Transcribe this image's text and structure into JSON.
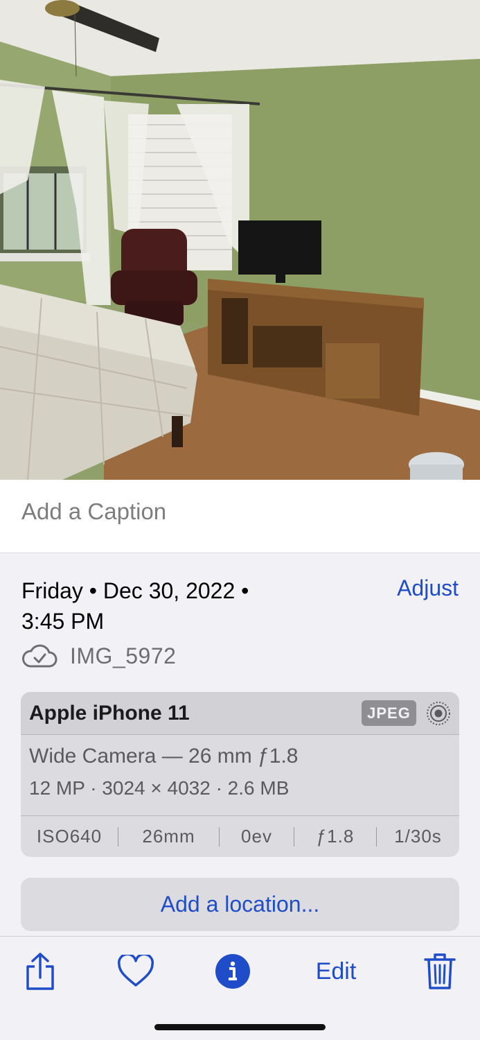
{
  "photo": {
    "description_icon": "bedroom-photo"
  },
  "caption": {
    "placeholder": "Add a Caption"
  },
  "metadata": {
    "date_line1": "Friday • Dec 30, 2022 •",
    "date_line2": "3:45 PM",
    "adjust_label": "Adjust",
    "filename": "IMG_5972",
    "cloud_icon": "icloud-check-icon"
  },
  "camera_card": {
    "device": "Apple iPhone 11",
    "format_badge": "JPEG",
    "live_icon": "live-photo-icon",
    "lens": "Wide Camera — 26 mm ƒ1.8",
    "specs": "12 MP · 3024 × 4032 · 2.6 MB",
    "exif": [
      "ISO640",
      "26mm",
      "0ev",
      "ƒ1.8",
      "1/30s"
    ]
  },
  "location": {
    "label": "Add a location..."
  },
  "toolbar": {
    "share_icon": "share-icon",
    "favorite_icon": "heart-icon",
    "info_icon": "info-icon",
    "edit_label": "Edit",
    "delete_icon": "trash-icon"
  },
  "colors": {
    "accent": "#1f4cc9",
    "background": "#f2f2f6",
    "card": "#dcdce0"
  }
}
